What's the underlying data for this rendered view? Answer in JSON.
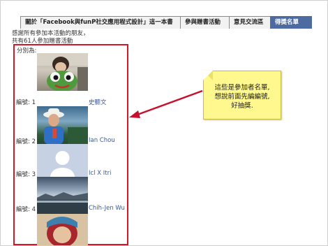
{
  "tabs": [
    {
      "label": "關於「Facebook與funP社交應用程式設計」這一本書",
      "active": false
    },
    {
      "label": "參與贈書活動",
      "active": false
    },
    {
      "label": "意見交流區",
      "active": false
    },
    {
      "label": "得獎名單",
      "active": true
    }
  ],
  "intro": {
    "line1": "感謝所有參加本活動的朋友，",
    "line2": "共有61人參加贈書活動"
  },
  "list_heading": "分別為:",
  "entries": [
    {
      "number_label": "編號: 1",
      "name": "史聽文"
    },
    {
      "number_label": "編號: 2",
      "name": "Ian Chou"
    },
    {
      "number_label": "編號: 3",
      "name": "Icl X Itri"
    },
    {
      "number_label": "編號: 4",
      "name": "Chih-Jen Wu"
    }
  ],
  "callout": {
    "line1": "這些是參加者名單,",
    "line2": "想說前面先編編號,",
    "line3": "好抽獎."
  },
  "colors": {
    "accent": "#4d6aa1",
    "link": "#3b5998",
    "highlight_border": "#d0182a",
    "callout_bg": "#fff88f"
  }
}
